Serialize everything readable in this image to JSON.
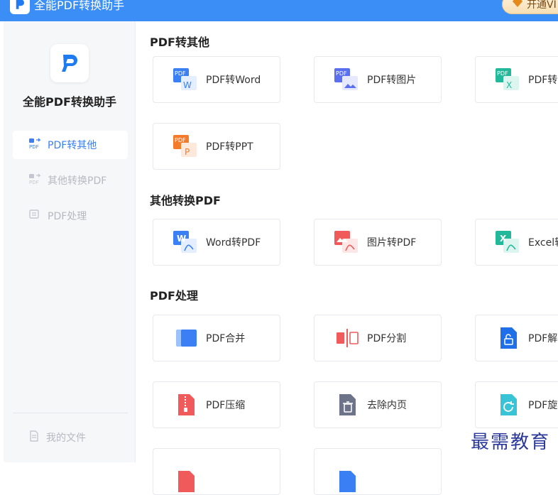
{
  "window": {
    "title": "全能PDF转换助手",
    "vip_label": "开通VI"
  },
  "sidebar": {
    "app_name": "全能PDF转换助手",
    "items": [
      {
        "label": "PDF转其他",
        "active": true
      },
      {
        "label": "其他转换PDF",
        "active": false
      },
      {
        "label": "PDF处理",
        "active": false
      }
    ],
    "footer_label": "我的文件"
  },
  "sections": [
    {
      "title": "PDF转其他"
    },
    {
      "title": "其他转换PDF"
    },
    {
      "title": "PDF处理"
    }
  ],
  "tiles": {
    "pdf_to_word": "PDF转Word",
    "pdf_to_image": "PDF转图片",
    "pdf_to_excel": "PDF转E",
    "pdf_to_ppt": "PDF转PPT",
    "word_to_pdf": "Word转PDF",
    "image_to_pdf": "图片转PDF",
    "excel_to_pdf": "Excel转",
    "pdf_merge": "PDF合并",
    "pdf_split": "PDF分割",
    "pdf_unlock": "PDF解密",
    "pdf_compress": "PDF压缩",
    "remove_pages": "去除内页",
    "pdf_rotate": "PDF旋转"
  },
  "icon_badges": {
    "pdf": "PDF",
    "word": "W",
    "excel": "X",
    "ppt": "P"
  },
  "watermark": "最需教育",
  "colors": {
    "accent": "#3b8ef5",
    "active_nav_text": "#3b7ff5",
    "inactive_nav_text": "#b6b9c2"
  }
}
